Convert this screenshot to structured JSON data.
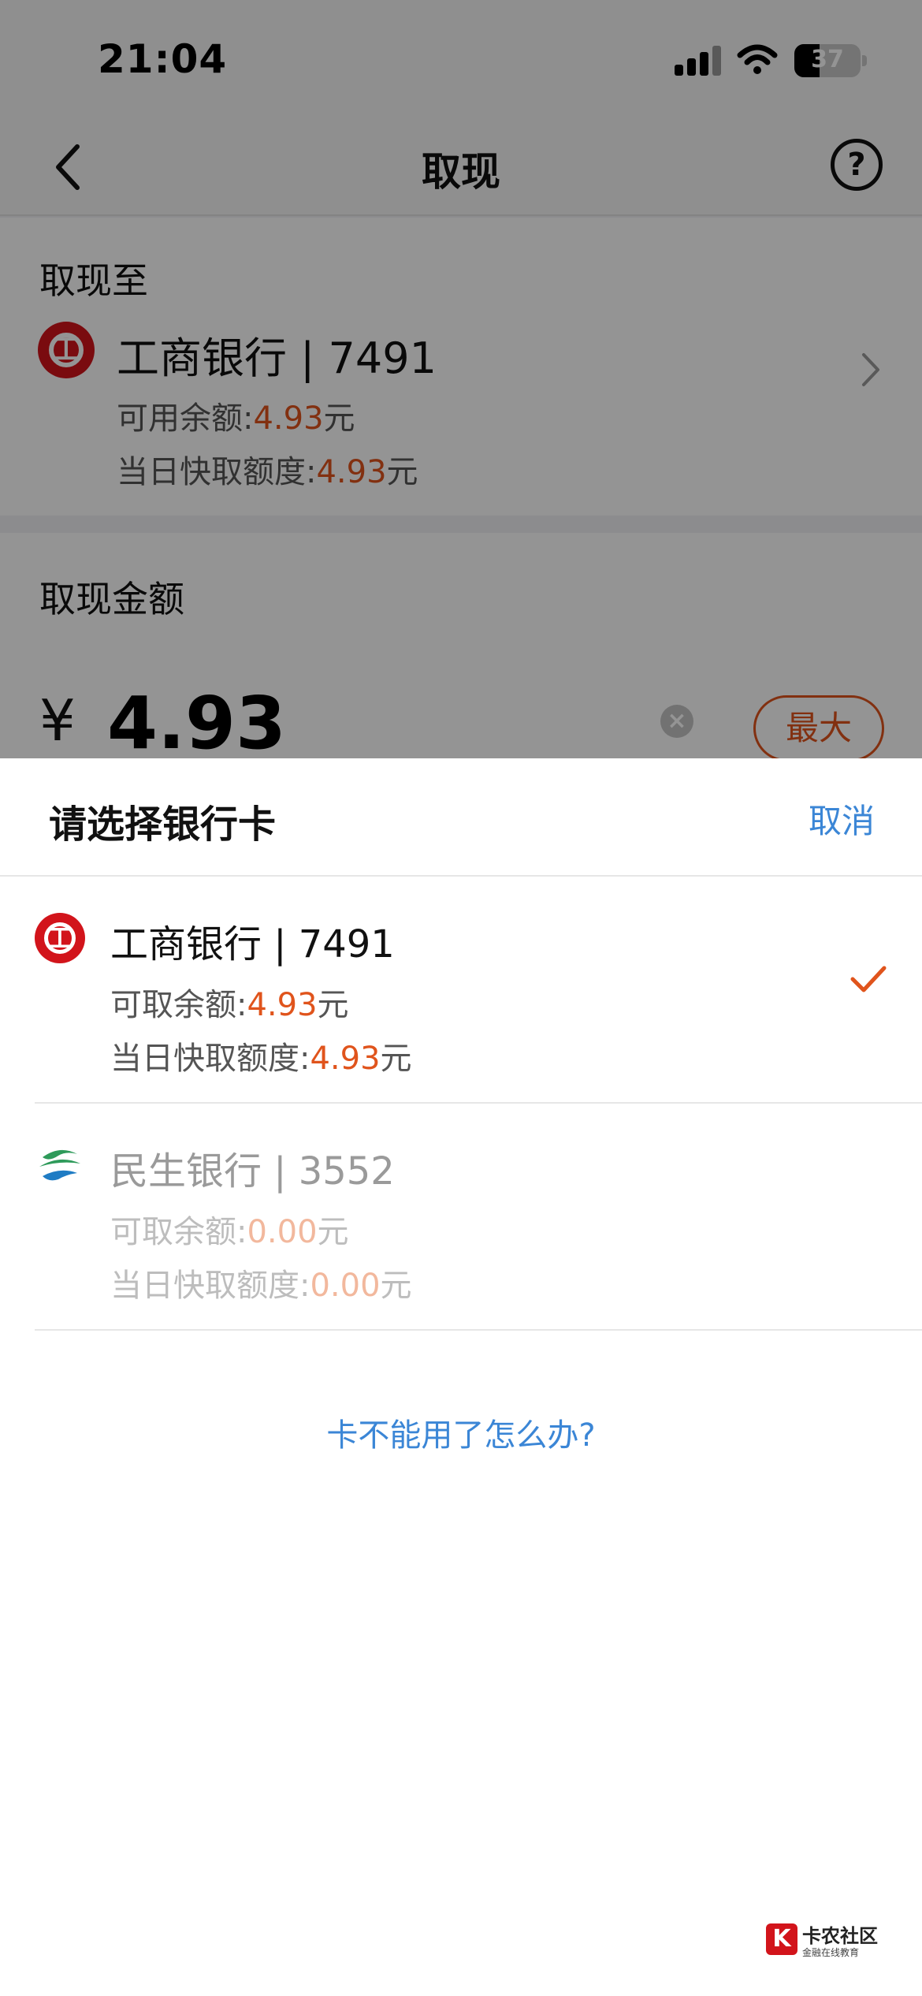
{
  "status_bar": {
    "time": "21:04",
    "battery": "37"
  },
  "nav": {
    "title": "取现",
    "help_icon": "question-circle-icon",
    "back_icon": "chevron-left-icon"
  },
  "withdraw_to": {
    "label": "取现至",
    "bank": "工商银行 | 7491",
    "available_label": "可用余额:",
    "available_amount": "4.93",
    "available_unit": "元",
    "quick_label": "当日快取额度:",
    "quick_amount": "4.93",
    "quick_unit": "元"
  },
  "amount_section": {
    "label": "取现金额",
    "currency": "¥",
    "value": "4.93",
    "max_label": "最大"
  },
  "sheet": {
    "title": "请选择银行卡",
    "cancel_label": "取消",
    "cards": [
      {
        "name": "工商银行 | 7491",
        "withdrawable_label": "可取余额:",
        "withdrawable_amount": "4.93",
        "unit": "元",
        "quick_label": "当日快取额度:",
        "quick_amount": "4.93",
        "selected": true
      },
      {
        "name": "民生银行 | 3552",
        "withdrawable_label": "可取余额:",
        "withdrawable_amount": "0.00",
        "unit": "元",
        "quick_label": "当日快取额度:",
        "quick_amount": "0.00",
        "selected": false
      }
    ],
    "help_link": "卡不能用了怎么办?"
  },
  "watermark": {
    "logo_text": "K",
    "title": "卡农社区",
    "subtitle": "金融在线教育"
  },
  "colors": {
    "accent": "#e0541c",
    "link": "#3b86d6",
    "icbc_red": "#d2141b"
  }
}
